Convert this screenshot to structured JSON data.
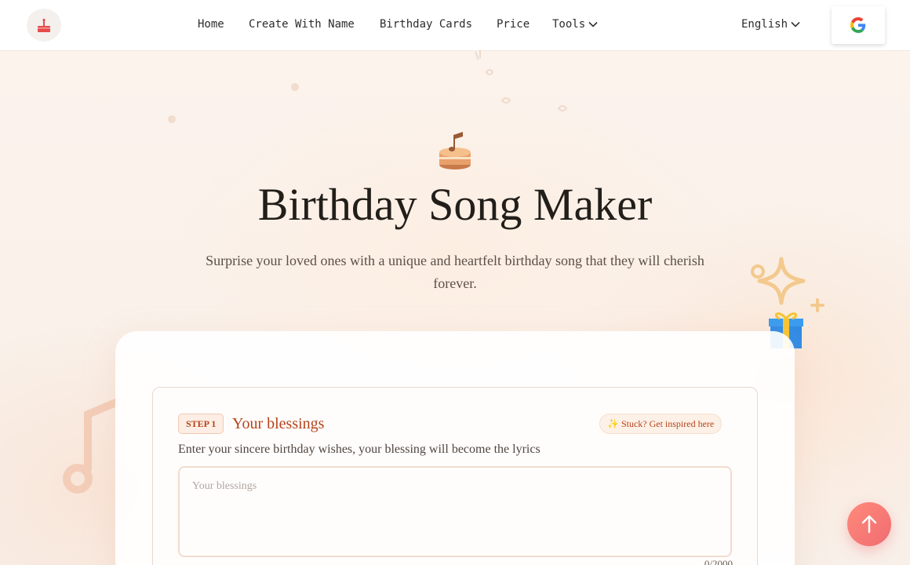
{
  "header": {
    "nav": [
      {
        "label": "Home"
      },
      {
        "label": "Create With Name"
      },
      {
        "label": "Birthday Cards"
      },
      {
        "label": "Price"
      },
      {
        "label": "Tools"
      }
    ],
    "language": "English"
  },
  "hero": {
    "title": "Birthday Song Maker",
    "subtitle": "Surprise your loved ones with a unique and heartfelt birthday song that they will cherish forever."
  },
  "step1": {
    "badge": "STEP 1",
    "title": "Your blessings",
    "inspire": "✨  Stuck? Get inspired here",
    "description": "Enter your sincere birthday wishes, your blessing will become the lyrics",
    "placeholder": "Your blessings",
    "value": "",
    "counter": "0/2000"
  },
  "colors": {
    "accent": "#b4441c",
    "scroll_top": "#f06c72",
    "background": "#fbf4ee"
  },
  "icons": {
    "logo": "cake-icon",
    "google": "google-icon",
    "hero": "music-cake-icon",
    "scroll_top": "arrow-up-icon"
  }
}
